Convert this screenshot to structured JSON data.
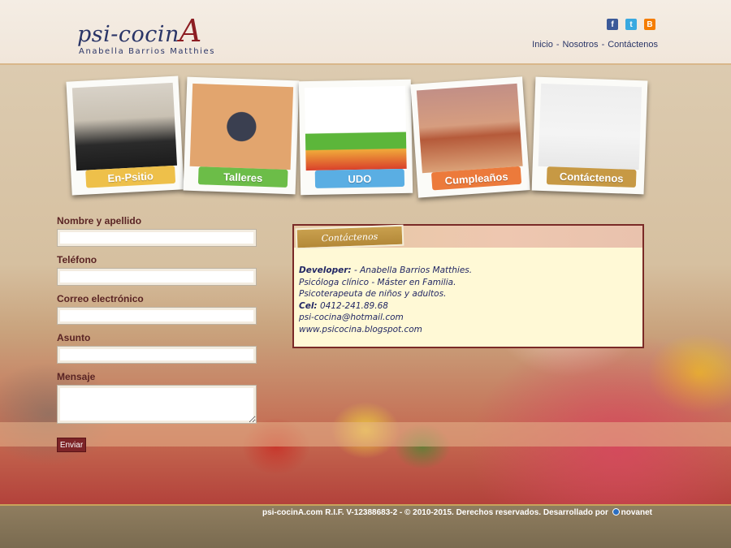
{
  "header": {
    "logo_prefix": "psi-cocin",
    "logo_letter": "A",
    "logo_subtitle": "Anabella Barrios Matthies",
    "social": [
      {
        "name": "facebook",
        "glyph": "f"
      },
      {
        "name": "twitter",
        "glyph": "t"
      },
      {
        "name": "blogger",
        "glyph": "B"
      }
    ],
    "nav": [
      "Inicio",
      "Nosotros",
      "Contáctenos"
    ],
    "nav_separator": "-"
  },
  "cards": [
    {
      "label": "En-Psitio",
      "color": "#eec04a"
    },
    {
      "label": "Talleres",
      "color": "#6cbd48"
    },
    {
      "label": "UDO",
      "color": "#5aaee3"
    },
    {
      "label": "Cumpleaños",
      "color": "#ec7a3b"
    },
    {
      "label": "Contáctenos",
      "color": "#c79944"
    }
  ],
  "form": {
    "name_label": "Nombre y apellido",
    "phone_label": "Teléfono",
    "email_label": "Correo electrónico",
    "subject_label": "Asunto",
    "message_label": "Mensaje",
    "submit_label": "Enviar"
  },
  "info": {
    "tab_title": "Contáctenos",
    "developer_label": "Developer:",
    "developer_value": " - Anabella Barrios Matthies.",
    "line2": "Psicóloga clínico - Máster en Familia.",
    "line3": "Psicoterapeuta de niños y adultos.",
    "cel_label": "Cel:",
    "cel_value": " 0412-241.89.68",
    "email": "psi-cocina@hotmail.com",
    "website": "www.psicocina.blogspot.com"
  },
  "footer": {
    "text": "psi-cocinA.com R.I.F. V-12388683-2 - © 2010-2015. Derechos reservados. Desarrollado por",
    "brand": "novanet"
  }
}
